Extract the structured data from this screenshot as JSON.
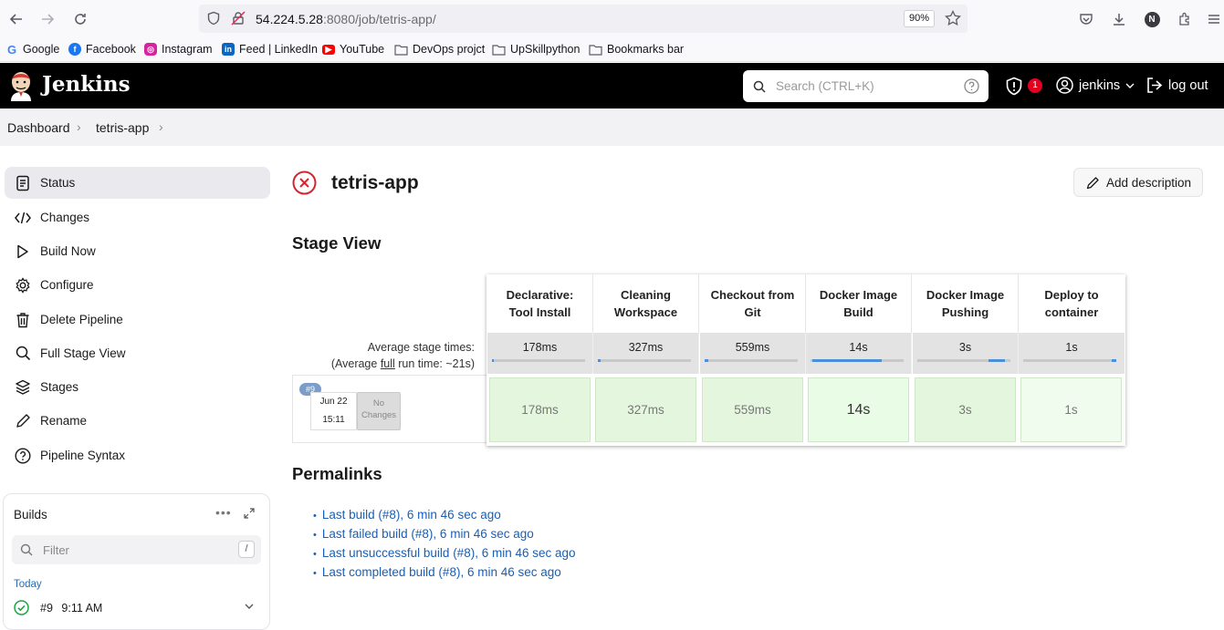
{
  "browser": {
    "url_host": "54.224.5.28",
    "url_rest": ":8080/job/tetris-app/",
    "zoom": "90%",
    "profile_initial": "N"
  },
  "bookmarks": [
    {
      "label": "Google",
      "icon": "google-icon"
    },
    {
      "label": "Facebook",
      "icon": "facebook-icon"
    },
    {
      "label": "Instagram",
      "icon": "instagram-icon"
    },
    {
      "label": "Feed | LinkedIn",
      "icon": "linkedin-icon"
    },
    {
      "label": "YouTube",
      "icon": "youtube-icon"
    },
    {
      "label": "DevOps projct",
      "icon": "folder-icon"
    },
    {
      "label": "UpSkillpython",
      "icon": "folder-icon"
    },
    {
      "label": "Bookmarks bar",
      "icon": "folder-icon"
    }
  ],
  "header": {
    "logo_text": "Jenkins",
    "search_placeholder": "Search (CTRL+K)",
    "security_count": "1",
    "user": "jenkins",
    "logout": "log out"
  },
  "breadcrumb": [
    "Dashboard",
    "tetris-app"
  ],
  "sidebar": {
    "items": [
      {
        "label": "Status",
        "icon": "status-icon"
      },
      {
        "label": "Changes",
        "icon": "code-icon"
      },
      {
        "label": "Build Now",
        "icon": "play-icon"
      },
      {
        "label": "Configure",
        "icon": "gear-icon"
      },
      {
        "label": "Delete Pipeline",
        "icon": "trash-icon"
      },
      {
        "label": "Full Stage View",
        "icon": "search-icon"
      },
      {
        "label": "Stages",
        "icon": "layers-icon"
      },
      {
        "label": "Rename",
        "icon": "pencil-icon"
      },
      {
        "label": "Pipeline Syntax",
        "icon": "help-icon"
      }
    ]
  },
  "builds": {
    "title": "Builds",
    "filter_placeholder": "Filter",
    "filter_shortcut": "/",
    "group": "Today",
    "items": [
      {
        "number": "#9",
        "time": "9:11 AM"
      }
    ]
  },
  "main": {
    "title": "tetris-app",
    "add_description": "Add description",
    "stage_view_title": "Stage View",
    "permalinks_title": "Permalinks",
    "permalinks": [
      "Last build (#8), 6 min 46 sec ago",
      "Last failed build (#8), 6 min 46 sec ago",
      "Last unsuccessful build (#8), 6 min 46 sec ago",
      "Last completed build (#8), 6 min 46 sec ago"
    ]
  },
  "stage_view": {
    "avg_label_1": "Average stage times:",
    "avg_label_2_pre": "(Average ",
    "avg_label_2_full": "full",
    "avg_label_2_post": " run time: ~21s)",
    "stages": [
      {
        "name": "Declarative: Tool Install",
        "avg": "178ms",
        "bar_start": 0.0,
        "bar_fill": 0.02
      },
      {
        "name": "Cleaning Workspace",
        "avg": "327ms",
        "bar_start": 0.0,
        "bar_fill": 0.03
      },
      {
        "name": "Checkout from Git",
        "avg": "559ms",
        "bar_start": 0.0,
        "bar_fill": 0.04
      },
      {
        "name": "Docker Image Build",
        "avg": "14s",
        "bar_start": 0.02,
        "bar_fill": 0.74
      },
      {
        "name": "Docker Image Pushing",
        "avg": "3s",
        "bar_start": 0.76,
        "bar_fill": 0.18
      },
      {
        "name": "Deploy to container",
        "avg": "1s",
        "bar_start": 0.95,
        "bar_fill": 0.05
      }
    ],
    "build": {
      "number": "#9",
      "date": "Jun 22",
      "time": "15:11",
      "changes": "No Changes",
      "durations": [
        "178ms",
        "327ms",
        "559ms",
        "14s",
        "3s",
        "1s"
      ]
    }
  }
}
